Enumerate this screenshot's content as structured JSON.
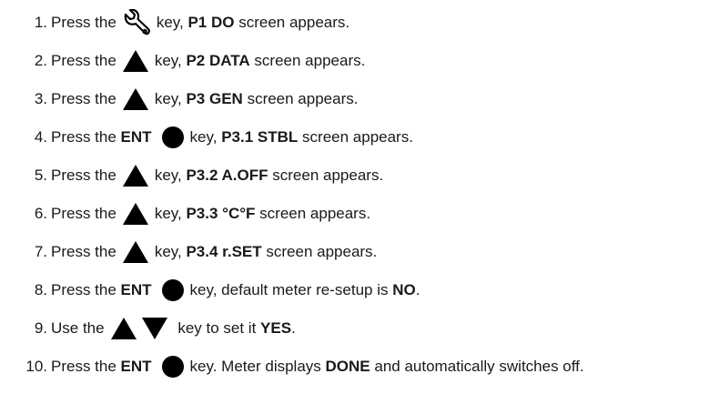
{
  "steps": [
    {
      "number": "1.",
      "before": "Press the",
      "icon": "wrench-icon",
      "after": "key,",
      "screen": "P1 DO",
      "end": "screen appears."
    },
    {
      "number": "2.",
      "before": "Press the",
      "icon": "up-triangle-icon",
      "after": "key,",
      "screen": "P2 DATA",
      "end": "screen appears."
    },
    {
      "number": "3.",
      "before": "Press the",
      "icon": "up-triangle-icon",
      "after": "key,",
      "screen": "P3 GEN",
      "end": "screen appears."
    },
    {
      "number": "4.",
      "before": "Press the",
      "key_label": "ENT",
      "icon": "circle-icon",
      "after": "key,",
      "screen": "P3.1 STBL",
      "end": "screen appears."
    },
    {
      "number": "5.",
      "before": "Press the",
      "icon": "up-triangle-icon",
      "after": "key,",
      "screen": "P3.2 A.OFF",
      "end": "screen appears."
    },
    {
      "number": "6.",
      "before": "Press the",
      "icon": "up-triangle-icon",
      "after": "key,",
      "screen": "P3.3 °C°F",
      "end": "screen appears."
    },
    {
      "number": "7.",
      "before": "Press the",
      "icon": "up-triangle-icon",
      "after": "key,",
      "screen": "P3.4 r.SET",
      "end": "screen appears."
    },
    {
      "number": "8.",
      "before": "Press the",
      "key_label": "ENT",
      "icon": "circle-icon",
      "after": "key, default meter re-setup is",
      "value": "NO",
      "end": "."
    },
    {
      "number": "9.",
      "before": "Use the",
      "icons": [
        "up-triangle-icon",
        "down-triangle-icon"
      ],
      "after": "key to set it",
      "value": "YES",
      "end": "."
    },
    {
      "number": "10.",
      "before": "Press the",
      "key_label": "ENT",
      "icon": "circle-icon",
      "after": "key. Meter displays",
      "value": "DONE",
      "end": "and automatically switches off."
    }
  ]
}
